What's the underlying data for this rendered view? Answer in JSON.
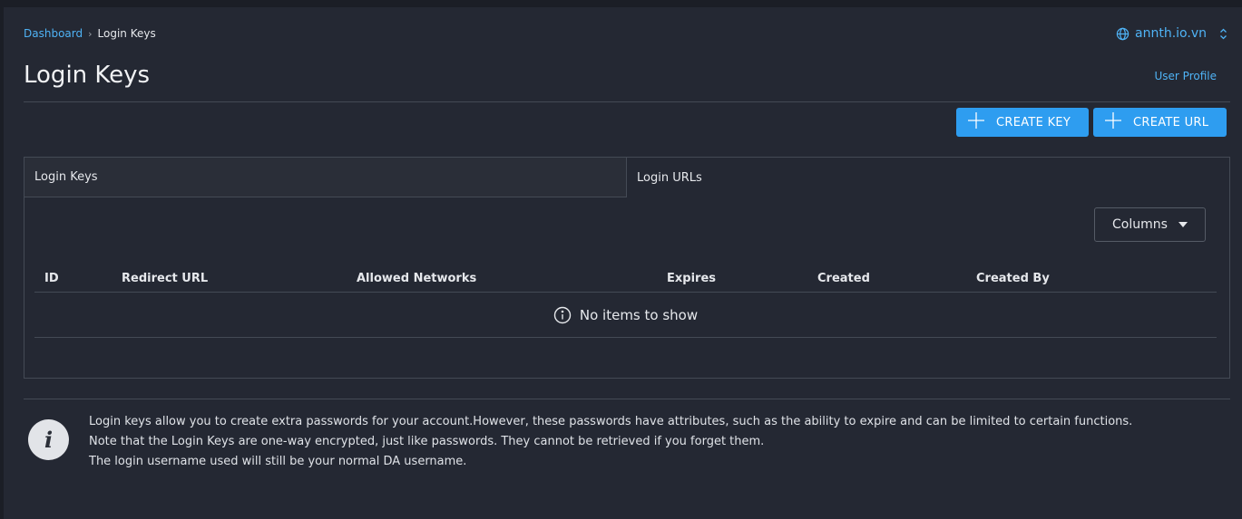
{
  "breadcrumb": {
    "items": [
      "Dashboard",
      "Login Keys"
    ],
    "separator": "›"
  },
  "domain": {
    "name": "annth.io.vn",
    "icon": "globe-icon"
  },
  "page": {
    "title": "Login Keys",
    "user_profile_label": "User Profile"
  },
  "actions": {
    "create_key_label": "CREATE KEY",
    "create_url_label": "CREATE URL"
  },
  "tabs": [
    {
      "label": "Login Keys",
      "active": false
    },
    {
      "label": "Login URLs",
      "active": true
    }
  ],
  "table": {
    "columns_button_label": "Columns",
    "headers": [
      "ID",
      "Redirect URL",
      "Allowed Networks",
      "Expires",
      "Created",
      "Created By"
    ],
    "empty_message": "No items to show"
  },
  "info": {
    "icon_letter": "i",
    "lines": [
      "Login keys allow you to create extra passwords for your account.However, these passwords have attributes, such as the ability to expire and can be limited to certain functions.",
      "Note that the Login Keys are one-way encrypted, just like passwords. They cannot be retrieved if you forget them.",
      "The login username used will still be your normal DA username."
    ]
  },
  "colors": {
    "background": "#242833",
    "accent": "#2e9df0",
    "link": "#4fb3f6",
    "border": "#444a55"
  }
}
